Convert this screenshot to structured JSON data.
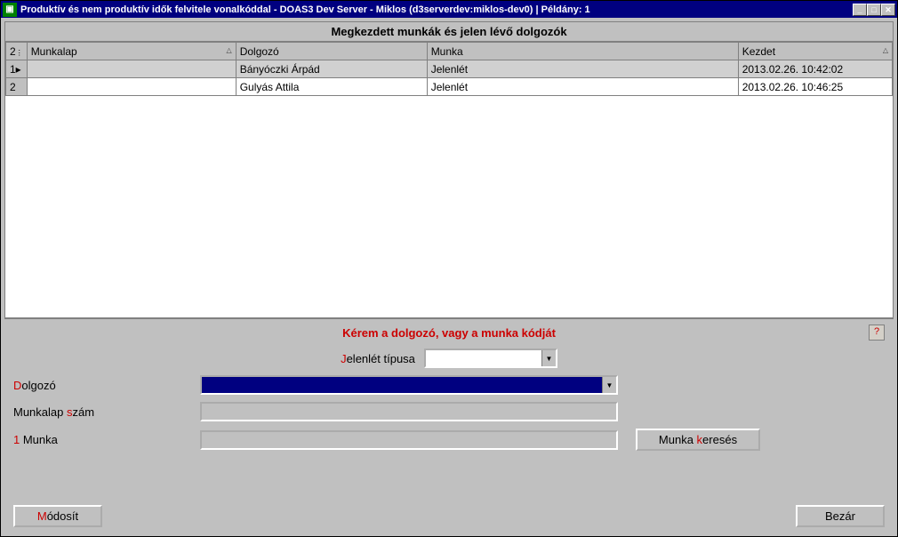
{
  "window": {
    "title": "Produktív és nem produktív idők felvitele vonalkóddal - DOAS3 Dev Server - Miklos (d3serverdev:miklos-dev0) | Példány: 1"
  },
  "grid": {
    "title": "Megkezdett munkák és jelen lévő dolgozók",
    "count_header": "2",
    "columns": {
      "munkalap": "Munkalap",
      "dolgozo": "Dolgozó",
      "munka": "Munka",
      "kezdet": "Kezdet"
    },
    "rows": [
      {
        "num": "1",
        "selected": true,
        "munkalap": "",
        "dolgozo": "Bányóczki Árpád",
        "munka": "Jelenlét",
        "kezdet": "2013.02.26. 10:42:02"
      },
      {
        "num": "2",
        "selected": false,
        "munkalap": "",
        "dolgozo": "Gulyás Attila",
        "munka": "Jelenlét",
        "kezdet": "2013.02.26. 10:46:25"
      }
    ]
  },
  "form": {
    "prompt": "Kérem a dolgozó, vagy a munka kódját",
    "help": "?",
    "jelen_label_pre": "J",
    "jelen_label_rest": "elenlét típusa",
    "jelen_value": "",
    "dolgozo_pre": "D",
    "dolgozo_rest": "olgozó",
    "dolgozo_value": "",
    "munkalap_pre": "Munkalap ",
    "munkalap_hot": "s",
    "munkalap_rest": "zám",
    "munkalap_value": "",
    "munka_pre": "1",
    "munka_rest": " Munka",
    "munka_value": "",
    "kereses_pre": "Munka ",
    "kereses_hot": "k",
    "kereses_rest": "eresés",
    "modosit_pre": "M",
    "modosit_rest": "ódosít",
    "bezar": "Bezár"
  }
}
